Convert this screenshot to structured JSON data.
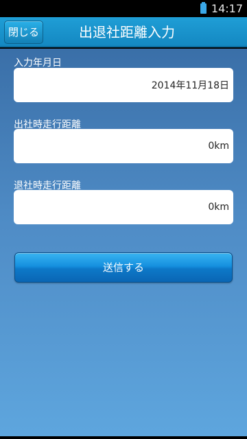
{
  "status_bar": {
    "time": "14:17"
  },
  "header": {
    "title": "出退社距離入力",
    "close_label": "閉じる"
  },
  "form": {
    "date_label": "入力年月日",
    "date_value": "2014年11月18日",
    "departure_label": "出社時走行距離",
    "departure_value": "0km",
    "return_label": "退社時走行距離",
    "return_value": "0km",
    "submit_label": "送信する"
  },
  "colors": {
    "header_blue": "#1a94cc",
    "background_top": "#3a6fa8",
    "background_bottom": "#5ea6de",
    "button_blue": "#1590df"
  }
}
